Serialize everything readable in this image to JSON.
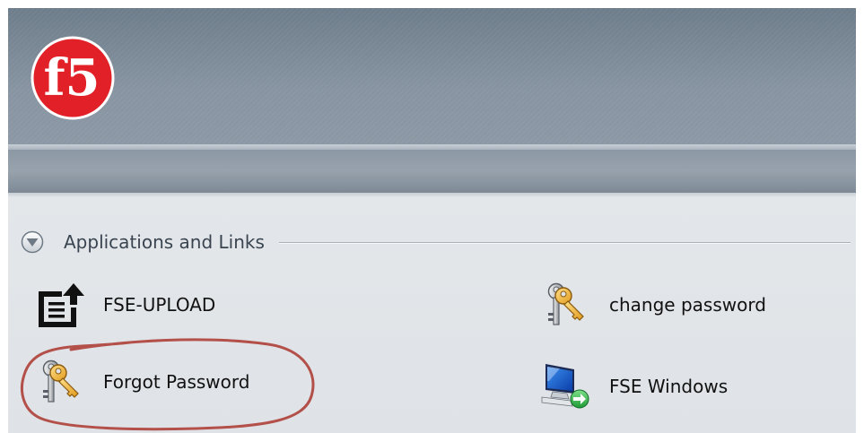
{
  "header": {
    "logo_text": "f5",
    "brand_color": "#e12127"
  },
  "section": {
    "title": "Applications and Links",
    "icon": "collapse-circle-icon"
  },
  "links": {
    "fse_upload": {
      "label": "FSE-UPLOAD",
      "icon": "upload-document-icon"
    },
    "forgot_password": {
      "label": "Forgot Password",
      "icon": "key-icon"
    },
    "change_password": {
      "label": "change password",
      "icon": "key-icon"
    },
    "fse_windows": {
      "label": "FSE Windows",
      "icon": "remote-desktop-icon"
    }
  },
  "annotation": {
    "color": "#b4504a"
  }
}
